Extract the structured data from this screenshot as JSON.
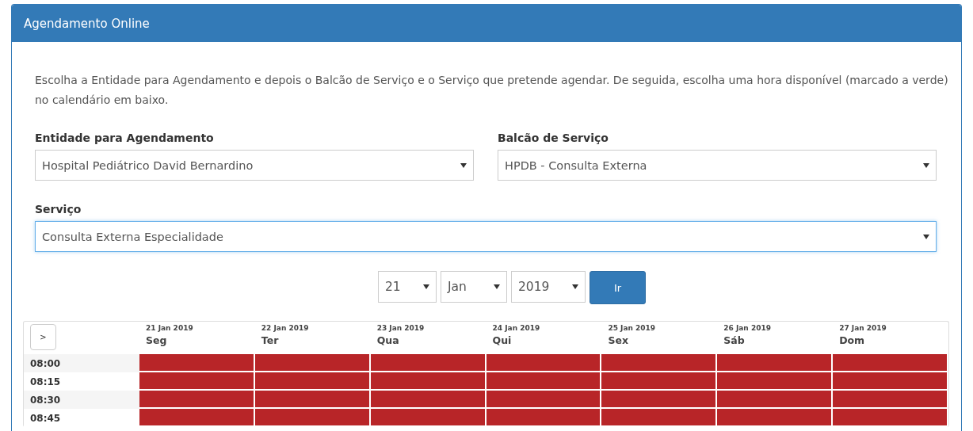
{
  "panel": {
    "title": "Agendamento Online"
  },
  "intro": "Escolha a Entidade para Agendamento e depois o Balcão de Serviço e o Serviço que pretende agendar. De seguida, escolha uma hora disponível (marcado a verde) no calendário em baixo.",
  "fields": [
    {
      "label": "Entidade para Agendamento",
      "value": "Hospital Pediátrico David Bernardino",
      "focused": false
    },
    {
      "label": "Balcão de Serviço",
      "value": "HPDB - Consulta Externa",
      "focused": false
    },
    {
      "label": "Serviço",
      "value": "Consulta Externa Especialidade",
      "focused": true
    }
  ],
  "date_picker": {
    "day": "21",
    "month": "Jan",
    "year": "2019",
    "button": "Ir"
  },
  "calendar": {
    "next_button": ">",
    "days": [
      {
        "date": "21 Jan 2019",
        "weekday": "Seg"
      },
      {
        "date": "22 Jan 2019",
        "weekday": "Ter"
      },
      {
        "date": "23 Jan 2019",
        "weekday": "Qua"
      },
      {
        "date": "24 Jan 2019",
        "weekday": "Qui"
      },
      {
        "date": "25 Jan 2019",
        "weekday": "Sex"
      },
      {
        "date": "26 Jan 2019",
        "weekday": "Sáb"
      },
      {
        "date": "27 Jan 2019",
        "weekday": "Dom"
      }
    ],
    "rows": [
      {
        "time": "08:00",
        "slots": [
          {
            "available": false
          },
          {
            "available": false
          },
          {
            "available": false
          },
          {
            "available": false
          },
          {
            "available": false
          },
          {
            "available": false
          },
          {
            "available": false
          }
        ]
      },
      {
        "time": "08:15",
        "slots": [
          {
            "available": false
          },
          {
            "available": false
          },
          {
            "available": false
          },
          {
            "available": false
          },
          {
            "available": false
          },
          {
            "available": false
          },
          {
            "available": false
          }
        ]
      },
      {
        "time": "08:30",
        "slots": [
          {
            "available": false
          },
          {
            "available": false
          },
          {
            "available": false
          },
          {
            "available": false
          },
          {
            "available": false
          },
          {
            "available": false
          },
          {
            "available": false
          }
        ]
      },
      {
        "time": "08:45",
        "slots": [
          {
            "available": false
          },
          {
            "available": false
          },
          {
            "available": false
          },
          {
            "available": false
          },
          {
            "available": false
          },
          {
            "available": false
          },
          {
            "available": false
          }
        ]
      }
    ]
  }
}
